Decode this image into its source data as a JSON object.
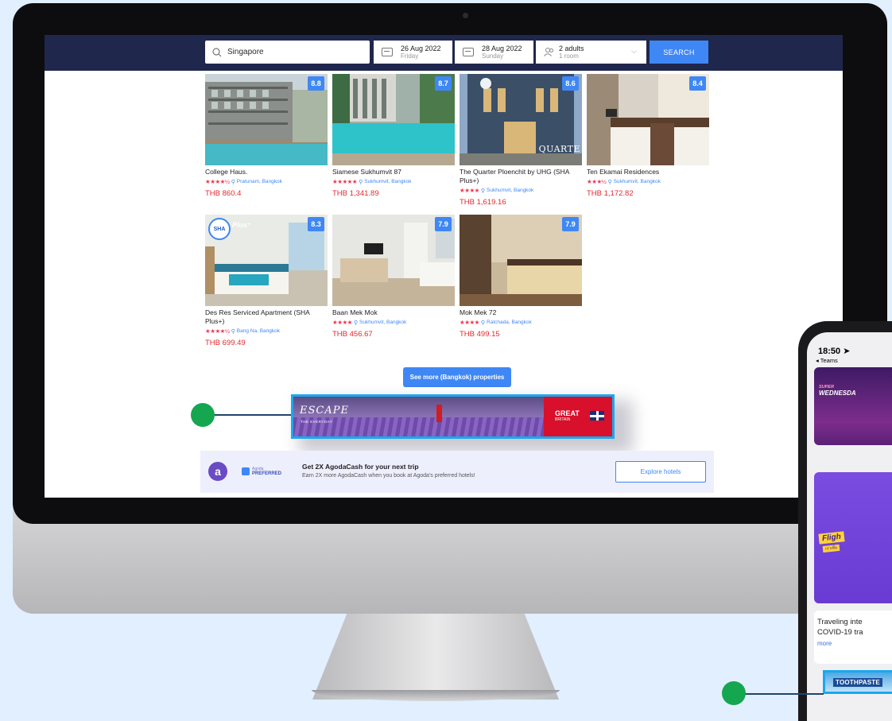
{
  "search": {
    "destination": "Singapore",
    "checkin_date": "26 Aug 2022",
    "checkin_day": "Friday",
    "checkout_date": "28 Aug 2022",
    "checkout_day": "Sunday",
    "guests": "2 adults",
    "rooms": "1 room",
    "button": "SEARCH"
  },
  "hotels": [
    {
      "name": "College Haus.",
      "score": "8.8",
      "stars": "★★★★½",
      "location": "Pratunam, Bangkok",
      "price": "THB 860.4"
    },
    {
      "name": "Siamese Sukhumvit 87",
      "score": "8.7",
      "stars": "★★★★★",
      "location": "Sukhumvit, Bangkok",
      "price": "THB 1,341.89"
    },
    {
      "name": "The Quarter Ploenchit by UHG (SHA Plus+)",
      "score": "8.6",
      "stars": "★★★★",
      "location": "Sukhumvit, Bangkok",
      "price": "THB 1,619.16",
      "image_text": "QUARTE"
    },
    {
      "name": "Ten Ekamai Residences",
      "score": "8.4",
      "stars": "★★★½",
      "location": "Sukhumvit, Bangkok",
      "price": "THB 1,172.82"
    },
    {
      "name": "Des Res Serviced Apartment (SHA Plus+)",
      "score": "8.3",
      "stars": "★★★★½",
      "location": "Bang Na, Bangkok",
      "price": "THB 699.49",
      "badge": "SHA",
      "badge2": "Plus⁺"
    },
    {
      "name": "Baan Mek Mok",
      "score": "7.9",
      "stars": "★★★★",
      "location": "Sukhumvit, Bangkok",
      "price": "THB 456.67"
    },
    {
      "name": "Mok Mek 72",
      "score": "7.9",
      "stars": "★★★★",
      "location": "Ratchada, Bangkok",
      "price": "THB 499.15"
    }
  ],
  "see_more": "See more (Bangkok) properties",
  "banner_ad": {
    "headline": "ESCAPE",
    "tagline": "THE EVERYDAY",
    "brand_line1": "GREAT",
    "brand_line2": "BRITAIN"
  },
  "promo": {
    "logo_letter": "a",
    "brand_small": "Agoda",
    "brand": "PREFERRED",
    "title": "Get 2X AgodaCash for your next trip",
    "subtitle": "Earn 2X more AgodaCash when you book at Agoda's preferred hotels!",
    "button": "Explore hotels"
  },
  "phone": {
    "time": "18:50",
    "back": "◂ Teams",
    "card1_small": "SUPER",
    "card1_big": "WEDNESDA",
    "card2_text": "Fligh",
    "card2_sub": "เราเที่ย",
    "text_line1": "Traveling inte",
    "text_line2": "COVID-19 tra",
    "more": "more",
    "ad_text": "TOOTHPASTE"
  },
  "colors": {
    "brand_blue": "#3f87f5",
    "nav": "#20274d",
    "price_red": "#e4282e",
    "marker_green": "#15a650",
    "highlight": "#1aa8f0"
  }
}
